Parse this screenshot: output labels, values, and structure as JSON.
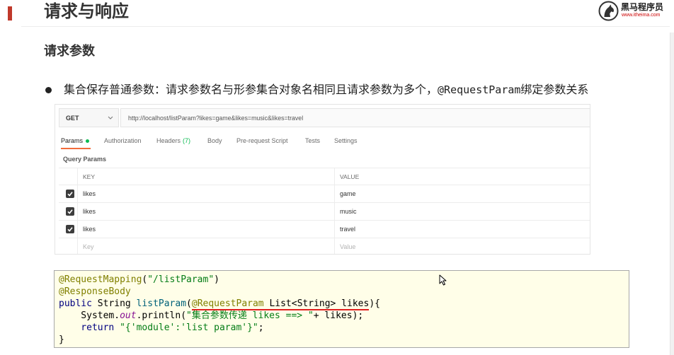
{
  "header": {
    "title": "请求与响应",
    "logo": {
      "name": "黑马程序员",
      "url": "www.itheima.com",
      "icon": "horse-logo-icon"
    }
  },
  "section": {
    "subtitle": "请求参数",
    "bullet": {
      "text_before": "集合保存普通参数：请求参数名与形参集合对象名相同且请求参数为多个，",
      "code": "@RequestParam",
      "text_after": "绑定参数关系"
    }
  },
  "postman": {
    "method": "GET",
    "url": "http://localhost/listParam?likes=game&likes=music&likes=travel",
    "tabs": [
      {
        "label": "Params",
        "active": true
      },
      {
        "label": "Authorization"
      },
      {
        "label": "Headers",
        "count": "(7)"
      },
      {
        "label": "Body"
      },
      {
        "label": "Pre-request Script"
      },
      {
        "label": "Tests"
      },
      {
        "label": "Settings"
      }
    ],
    "section_label": "Query Params",
    "columns": {
      "key": "KEY",
      "value": "VALUE"
    },
    "rows": [
      {
        "checked": true,
        "key": "likes",
        "value": "game"
      },
      {
        "checked": true,
        "key": "likes",
        "value": "music"
      },
      {
        "checked": true,
        "key": "likes",
        "value": "travel"
      }
    ],
    "new_row_placeholder": {
      "key": "Key",
      "value": "Value"
    }
  },
  "code": {
    "lines": [
      [
        "@RequestMapping",
        "(",
        "\"/listParam\"",
        ")"
      ],
      [
        "@ResponseBody"
      ],
      [
        "public",
        " String ",
        "listParam",
        "(",
        "@RequestParam",
        " List<String> likes",
        "){"
      ],
      [
        "System.",
        "out",
        ".println(",
        "\"集合参数传递 likes ==> \"",
        "+ likes);"
      ],
      [
        "return ",
        "\"{'module':'list param'}\"",
        ";"
      ],
      [
        "}"
      ]
    ]
  },
  "colors": {
    "accent_bar": "#c0392b",
    "logo_red": "#cc0000",
    "tab_active_underline": "#f26b3a",
    "status_green": "#0cbb52",
    "code_background": "#fffee8",
    "annotation": "#808000",
    "keyword": "#000080",
    "string": "#067d17",
    "method": "#00627a",
    "field": "#871094",
    "highlight_underline": "#e02020"
  }
}
